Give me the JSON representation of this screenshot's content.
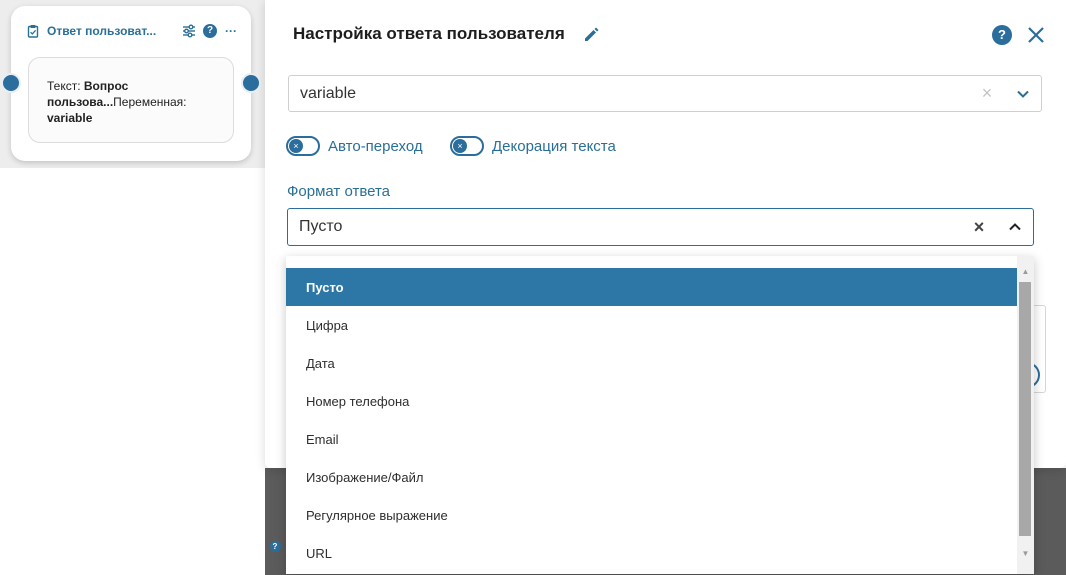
{
  "node": {
    "title": "Ответ пользоват...",
    "text_label": "Текст: ",
    "text_value_line1": "Вопрос",
    "text_value_line2": "пользова...",
    "var_label": "Переменная:",
    "var_value": "variable",
    "help_icon": "?",
    "more_icon": "···"
  },
  "modal": {
    "title": "Настройка ответа пользователя",
    "help_icon": "?",
    "variable_value": "variable",
    "toggle_auto_label": "Авто-переход",
    "toggle_decor_label": "Декорация текста",
    "format_label": "Формат ответа",
    "format_value": "Пусто",
    "clear_symbol": "×"
  },
  "dropdown": {
    "selected_index": 0,
    "options": [
      "Пусто",
      "Цифра",
      "Дата",
      "Номер телефона",
      "Email",
      "Изображение/Файл",
      "Регулярное выражение",
      "URL"
    ]
  },
  "canvas": {
    "chip": "?"
  },
  "colors": {
    "accent": "#2b6d9c",
    "selected_option": "#2d77a6",
    "label_text": "#2a6f97"
  },
  "icons": {
    "node_type": "clipboard-icon",
    "node_settings": "sliders-icon",
    "edit": "pencil-icon",
    "close": "close-icon",
    "dropdown_toggle": "chevron-icon"
  }
}
